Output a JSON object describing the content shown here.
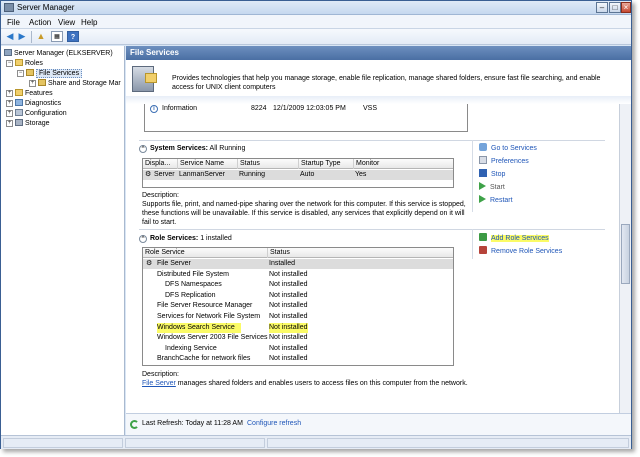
{
  "window": {
    "title": "Server Manager"
  },
  "menu": [
    "File",
    "Action",
    "View",
    "Help"
  ],
  "tree": {
    "root": "Server Manager (ELKSERVER)",
    "roles": "Roles",
    "file_services": "File Services",
    "share_storage": "Share and Storage Mar",
    "features": "Features",
    "diagnostics": "Diagnostics",
    "configuration": "Configuration",
    "storage": "Storage"
  },
  "pane": {
    "header": "File Services",
    "summary": "Provides technologies that help you manage storage, enable file replication, manage shared folders, ensure fast file searching, and enable access for UNIX client computers"
  },
  "event": {
    "level": "Information",
    "id": "8224",
    "date": "12/1/2009 12:03:05 PM",
    "source": "VSS"
  },
  "system_services": {
    "title": "System Services:",
    "state": "All Running",
    "columns": [
      "Displa...",
      "Service Name",
      "Status",
      "Startup Type",
      "Monitor"
    ],
    "rows": [
      {
        "display": "Server",
        "service": "LanmanServer",
        "status": "Running",
        "startup": "Auto",
        "monitor": "Yes"
      }
    ],
    "desc_label": "Description:",
    "description": "Supports file, print, and named-pipe sharing over the network for this computer. If this service is stopped, these functions will be unavailable. If this service is disabled, any services that explicitly depend on it will fail to start.",
    "actions": [
      "Go to Services",
      "Preferences",
      "Stop",
      "Start",
      "Restart"
    ]
  },
  "role_services": {
    "title": "Role Services:",
    "state": "1 installed",
    "columns": [
      "Role Service",
      "Status"
    ],
    "rows": [
      {
        "name": "File Server",
        "status": "Installed"
      },
      {
        "name": "Distributed File System",
        "status": "Not installed"
      },
      {
        "name": "DFS Namespaces",
        "status": "Not installed"
      },
      {
        "name": "DFS Replication",
        "status": "Not installed"
      },
      {
        "name": "File Server Resource Manager",
        "status": "Not installed"
      },
      {
        "name": "Services for Network File System",
        "status": "Not installed"
      },
      {
        "name": "Windows Search Service",
        "status": "Not installed"
      },
      {
        "name": "Windows Server 2003 File Services",
        "status": "Not installed"
      },
      {
        "name": "Indexing Service",
        "status": "Not installed"
      },
      {
        "name": "BranchCache for network files",
        "status": "Not installed"
      }
    ],
    "desc_label": "Description:",
    "desc_link": "File Server",
    "desc_text": " manages shared folders and enables users to access files on this computer from the network.",
    "actions": [
      "Add Role Services",
      "Remove Role Services"
    ]
  },
  "refresh": {
    "text": "Last Refresh: Today at 11:28 AM",
    "link": "Configure refresh"
  },
  "colors": {
    "header": "#4a6fa3",
    "link": "#1f56b8",
    "highlight": "#fbfb66"
  }
}
